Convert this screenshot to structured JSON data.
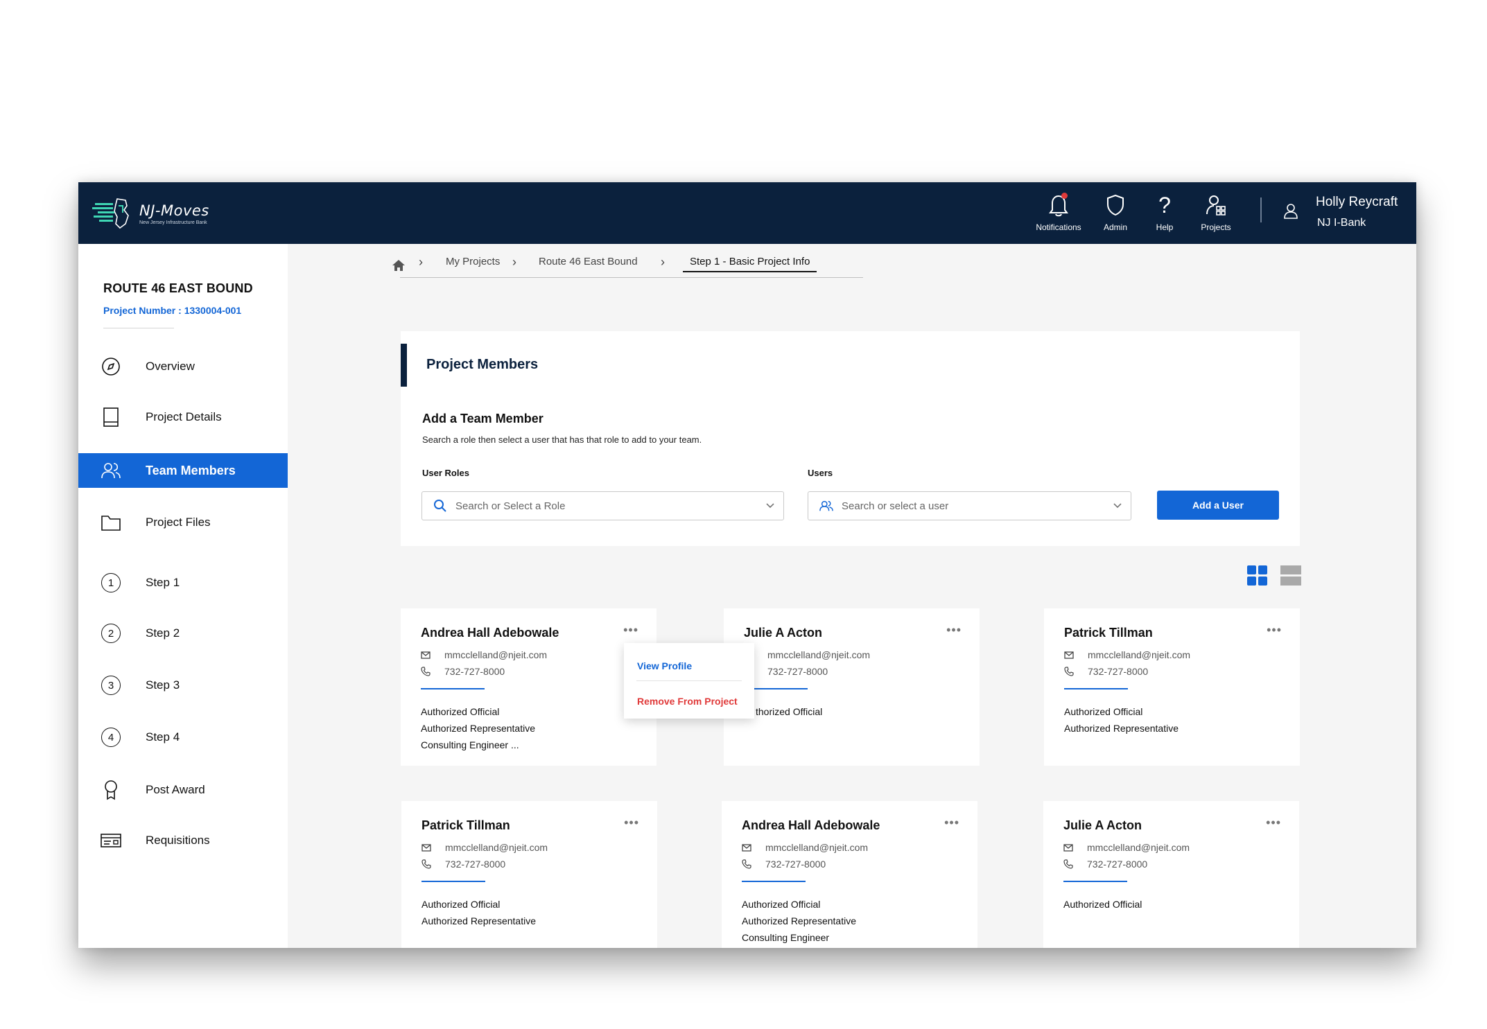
{
  "app": {
    "logo_name": "NJ-Moves",
    "logo_subtitle": "New Jersey Infrastructure Bank",
    "brand_color": "#0b213d",
    "accent_color": "#1366d6",
    "danger_color": "#e03a3a"
  },
  "topnav": {
    "items": [
      {
        "label": "Notifications",
        "icon": "bell-icon"
      },
      {
        "label": "Admin",
        "icon": "shield-icon"
      },
      {
        "label": "Help",
        "icon": "question-icon"
      },
      {
        "label": "Projects",
        "icon": "projects-icon"
      }
    ],
    "user": {
      "name": "Holly Reycraft",
      "org": "NJ I-Bank"
    }
  },
  "sidebar": {
    "project_title": "ROUTE 46 EAST BOUND",
    "project_number": "Project Number : 1330004-001",
    "items": [
      {
        "label": "Overview",
        "icon": "compass-icon"
      },
      {
        "label": "Project Details",
        "icon": "book-icon"
      },
      {
        "label": "Team Members",
        "icon": "users-icon",
        "active": true
      },
      {
        "label": "Project Files",
        "icon": "folder-icon"
      },
      {
        "label": "Step 1",
        "step": "1"
      },
      {
        "label": "Step 2",
        "step": "2"
      },
      {
        "label": "Step 3",
        "step": "3"
      },
      {
        "label": "Step 4",
        "step": "4"
      },
      {
        "label": "Post Award",
        "icon": "award-icon"
      },
      {
        "label": "Requisitions",
        "icon": "requisition-icon"
      }
    ]
  },
  "breadcrumb": {
    "items": [
      "My Projects",
      "Route 46 East Bound",
      "Step 1 - Basic Project Info"
    ]
  },
  "panel": {
    "title": "Project Members",
    "add_title": "Add a Team Member",
    "add_description": "Search a role then select a user that has that role to add to your team.",
    "roles_label": "User Roles",
    "roles_placeholder": "Search or Select a Role",
    "users_label": "Users",
    "users_placeholder": "Search or select a user",
    "add_button": "Add a User"
  },
  "members": [
    {
      "name": "Andrea Hall Adebowale",
      "email": "mmcclelland@njeit.com",
      "phone": "732-727-8000",
      "roles": [
        "Authorized Official",
        "Authorized Representative",
        "Consulting Engineer ..."
      ]
    },
    {
      "name": "Julie A Acton",
      "email": "mmcclelland@njeit.com",
      "phone": "732-727-8000",
      "roles": [
        "thorized Official"
      ]
    },
    {
      "name": "Patrick Tillman",
      "email": "mmcclelland@njeit.com",
      "phone": "732-727-8000",
      "roles": [
        "Authorized Official",
        "Authorized Representative"
      ]
    },
    {
      "name": "Patrick Tillman",
      "email": "mmcclelland@njeit.com",
      "phone": "732-727-8000",
      "roles": [
        "Authorized Official",
        "Authorized Representative"
      ]
    },
    {
      "name": "Andrea Hall Adebowale",
      "email": "mmcclelland@njeit.com",
      "phone": "732-727-8000",
      "roles": [
        "Authorized Official",
        "Authorized Representative",
        "Consulting Engineer"
      ]
    },
    {
      "name": "Julie A Acton",
      "email": "mmcclelland@njeit.com",
      "phone": "732-727-8000",
      "roles": [
        "Authorized Official"
      ]
    }
  ],
  "popup": {
    "view_profile": "View Profile",
    "remove": "Remove From Project"
  }
}
